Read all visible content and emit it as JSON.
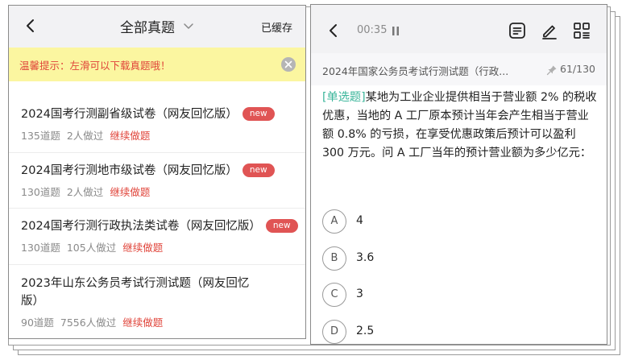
{
  "left": {
    "header": {
      "title": "全部真题",
      "saved": "已缓存"
    },
    "tip": {
      "text": "温馨提示：左滑可以下载真题哦！"
    },
    "items": [
      {
        "title": "2024国考行测副省级试卷（网友回忆版）",
        "badge": "new",
        "count": "135道题",
        "done": "2人做过",
        "cont": "继续做题"
      },
      {
        "title": "2024国考行测地市级试卷（网友回忆版）",
        "badge": "new",
        "count": "130道题",
        "done": "2人做过",
        "cont": "继续做题"
      },
      {
        "title": "2024国考行测行政执法类试卷（网友回忆版）",
        "badge": "new",
        "count": "130道题",
        "done": "105人做过",
        "cont": "继续做题"
      },
      {
        "title": "2023年山东公务员考试行测试题（网友回忆版）",
        "badge": "",
        "count": "90道题",
        "done": "7556人做过",
        "cont": "继续做题"
      }
    ]
  },
  "right": {
    "header": {
      "timer": "00:35"
    },
    "sub": {
      "title": "2024年国家公务员考试行测试题（行政...",
      "count": "61/130"
    },
    "question": {
      "type": "[单选题]",
      "text": "某地为工业企业提供相当于营业额 2% 的税收优惠，当地的 A 工厂原本预计当年会产生相当于营业额 0.8% 的亏损，在享受优惠政策后预计可以盈利 300 万元。问 A 工厂当年的预计营业额为多少亿元："
    },
    "options": [
      {
        "letter": "A",
        "text": "4"
      },
      {
        "letter": "B",
        "text": "3.6"
      },
      {
        "letter": "C",
        "text": "3"
      },
      {
        "letter": "D",
        "text": "2.5"
      }
    ]
  }
}
